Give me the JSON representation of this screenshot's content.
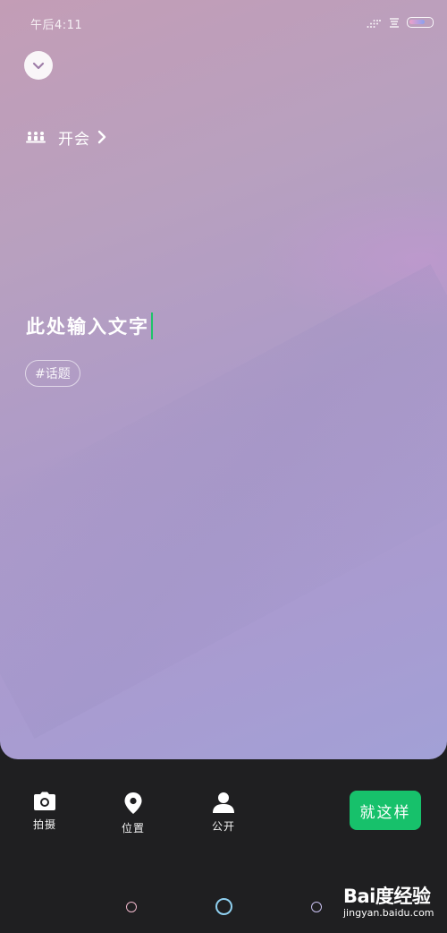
{
  "status_bar": {
    "time": "午后4:11",
    "battery_level": 0.72,
    "icons": [
      "signal-icon",
      "wifi-icon",
      "battery-icon"
    ]
  },
  "collapse_button": {
    "icon": "chevron-down-icon"
  },
  "activity": {
    "icon": "people-group-icon",
    "label": "开会"
  },
  "editor": {
    "text": "此处输入文字"
  },
  "topic_tag": {
    "label": "#话题"
  },
  "toolbar": {
    "camera": {
      "label": "拍摄",
      "icon": "camera-icon"
    },
    "location": {
      "label": "位置",
      "icon": "location-pin-icon"
    },
    "visibility": {
      "label": "公开",
      "icon": "person-icon"
    },
    "confirm_label": "就这样"
  },
  "colors": {
    "accent_green": "#17c16b",
    "cursor_green": "#1fc36a",
    "toolbar_background": "#1f1f21"
  },
  "watermark": {
    "logo": "Bai度经验",
    "url": "jingyan.baidu.com"
  }
}
